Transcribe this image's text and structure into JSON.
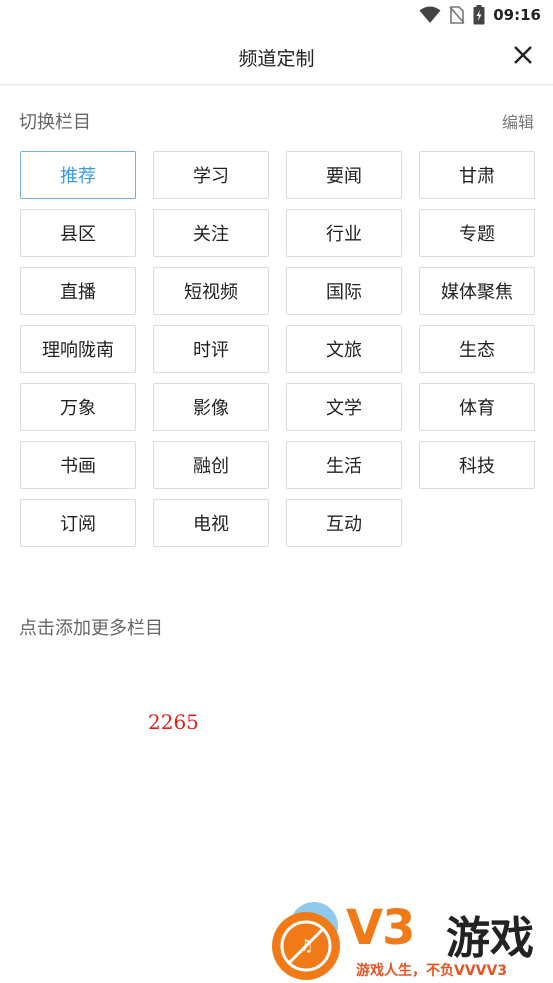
{
  "status_bar": {
    "time": "09:16"
  },
  "header": {
    "title": "频道定制"
  },
  "section": {
    "label": "切换栏目",
    "edit_label": "编辑"
  },
  "channels": [
    "推荐",
    "学习",
    "要闻",
    "甘肃",
    "县区",
    "关注",
    "行业",
    "专题",
    "直播",
    "短视频",
    "国际",
    "媒体聚焦",
    "理响陇南",
    "时评",
    "文旅",
    "生态",
    "万象",
    "影像",
    "文学",
    "体育",
    "书画",
    "融创",
    "生活",
    "科技",
    "订阅",
    "电视",
    "互动"
  ],
  "active_channel": "推荐",
  "more": {
    "label": "点击添加更多栏目"
  },
  "overlay_number": "2265",
  "watermark": {
    "brand": "V3",
    "brand_cn": "游戏",
    "slogan": "游戏人生，不负VVVV3"
  },
  "colors": {
    "accent": "#3a9be0",
    "number": "#e02020",
    "watermark_orange": "#f07a17"
  }
}
